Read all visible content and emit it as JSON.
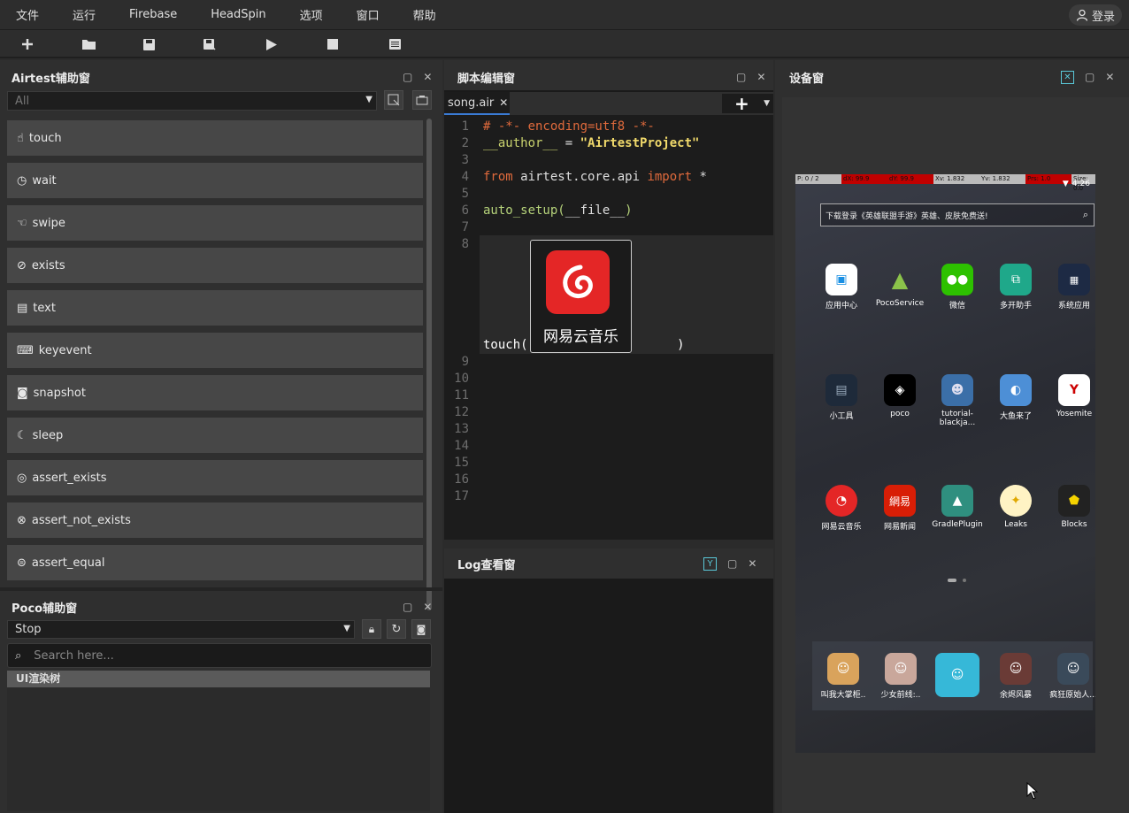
{
  "menubar": {
    "items": [
      "文件",
      "运行",
      "Firebase",
      "HeadSpin",
      "选项",
      "窗口",
      "帮助"
    ],
    "login": "登录"
  },
  "airtest_panel": {
    "title": "Airtest辅助窗",
    "filter_value": "All",
    "apis": [
      "touch",
      "wait",
      "swipe",
      "exists",
      "text",
      "keyevent",
      "snapshot",
      "sleep",
      "assert_exists",
      "assert_not_exists",
      "assert_equal"
    ]
  },
  "poco_panel": {
    "title": "Poco辅助窗",
    "mode": "Stop",
    "search_placeholder": "Search here...",
    "tree_root": "UI渲染树"
  },
  "script_panel": {
    "title": "脚本编辑窗",
    "tab": "song.air",
    "lines": [
      {
        "n": "1",
        "text": "# -*- encoding=utf8 -*-"
      },
      {
        "n": "2",
        "text": "__author__ = \"AirtestProject\""
      },
      {
        "n": "3",
        "text": ""
      },
      {
        "n": "4",
        "text": "from airtest.core.api import *"
      },
      {
        "n": "5",
        "text": ""
      },
      {
        "n": "6",
        "text": "auto_setup(__file__)"
      },
      {
        "n": "7",
        "text": ""
      },
      {
        "n": "8",
        "text": "touch(                    )"
      },
      {
        "n": "9",
        "text": ""
      },
      {
        "n": "10",
        "text": ""
      },
      {
        "n": "11",
        "text": ""
      },
      {
        "n": "12",
        "text": ""
      },
      {
        "n": "13",
        "text": ""
      },
      {
        "n": "14",
        "text": ""
      },
      {
        "n": "15",
        "text": ""
      },
      {
        "n": "16",
        "text": ""
      },
      {
        "n": "17",
        "text": ""
      }
    ],
    "image_label": "网易云音乐"
  },
  "log_panel": {
    "title": "Log查看窗"
  },
  "device_panel": {
    "title": "设备窗",
    "pointer_bar": [
      "P: 0 / 2",
      "dX: 99.9",
      "dY: 99.9",
      "Xv: 1.832",
      "Yv: 1.832",
      "Prs: 1.0",
      "Size: 0.0"
    ],
    "time": "4:26",
    "search_text": "下载登录《英雄联盟手游》英雄、皮肤免费送!",
    "apps_row1": [
      "应用中心",
      "PocoService",
      "微信",
      "多开助手",
      "系统应用"
    ],
    "apps_row2": [
      "小工具",
      "poco",
      "tutorial-blackja...",
      "大鱼来了",
      "Yosemite"
    ],
    "apps_row3": [
      "网易云音乐",
      "网易新闻",
      "GradlePlugin",
      "Leaks",
      "Blocks"
    ],
    "dock": [
      "叫我大掌柜..",
      "少女前线:..",
      "",
      "余烬风暴",
      "疯狂原始人..."
    ]
  },
  "colors": {
    "accent_red": "#e42626",
    "bar_red": "#c00000",
    "panel_bg": "#2f2f2f"
  }
}
